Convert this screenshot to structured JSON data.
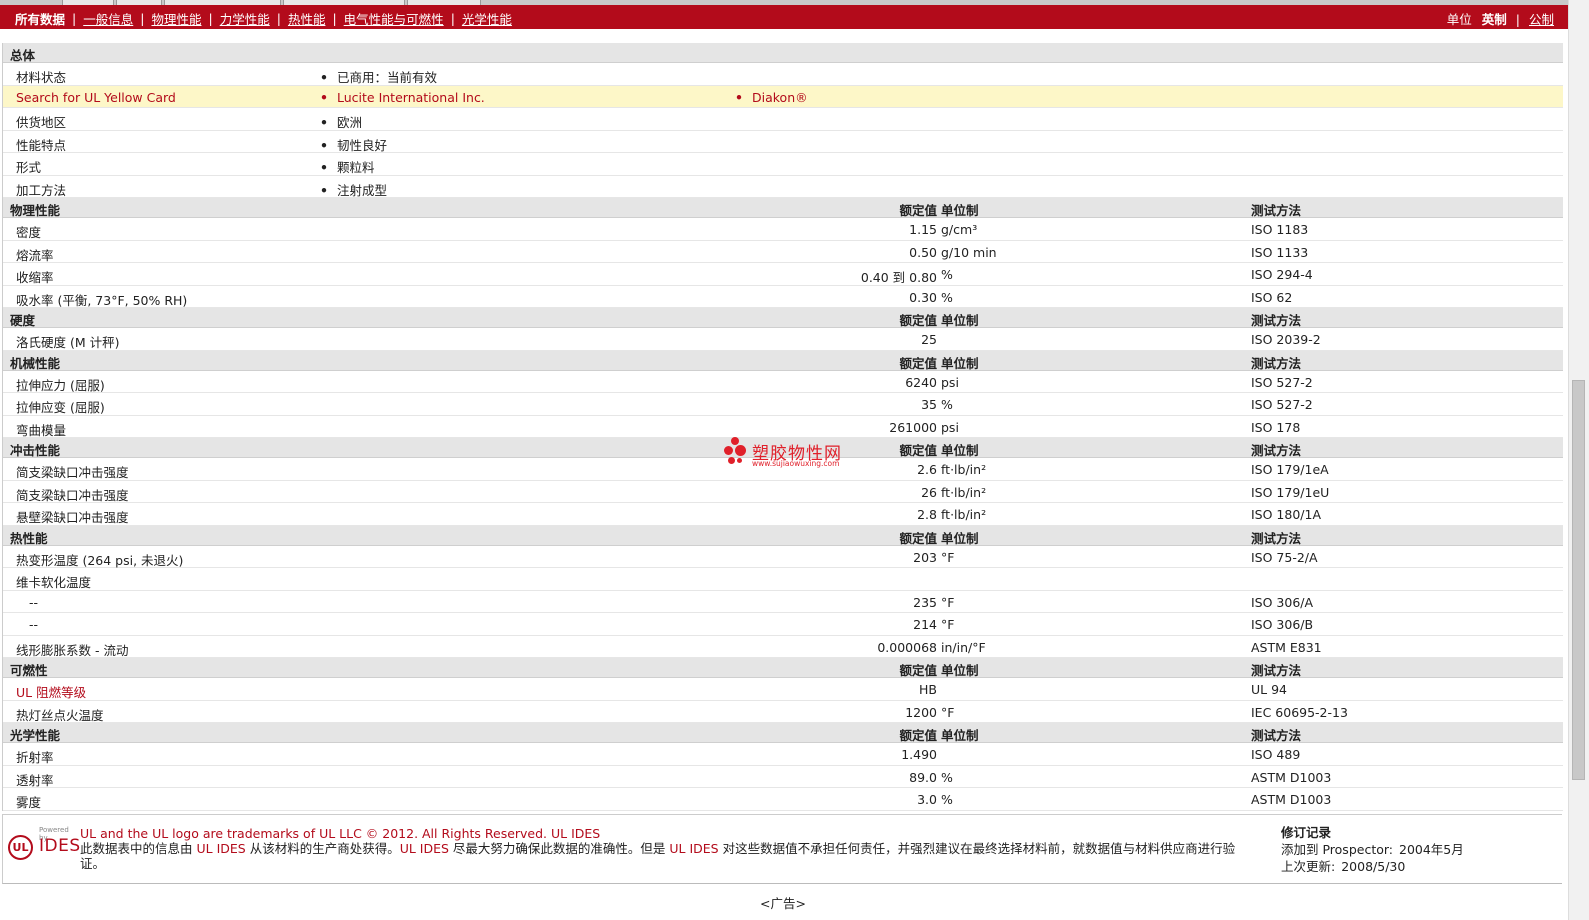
{
  "nav": {
    "items": [
      "所有数据",
      "一般信息",
      "物理性能",
      "力学性能",
      "热性能",
      "电气性能与可燃性",
      "光学性能"
    ],
    "active": "所有数据",
    "units_label": "单位",
    "units_current": "英制",
    "units_alt": "公制"
  },
  "colors": {
    "brand": "#b30b1b",
    "highlight": "#fdf7c8",
    "section_bg": "#e5e5e5"
  },
  "general": {
    "title": "总体",
    "rows": [
      {
        "name": "材料状态",
        "b1": "已商用：当前有效"
      },
      {
        "name": "Search for UL Yellow Card",
        "b1": "Lucite International Inc.",
        "b2": "Diakon®"
      },
      {
        "name": "供货地区",
        "b1": "欧洲"
      },
      {
        "name": "性能特点",
        "b1": "韧性良好"
      },
      {
        "name": "形式",
        "b1": "颗粒料"
      },
      {
        "name": "加工方法",
        "b1": "注射成型"
      }
    ]
  },
  "headers": {
    "value": "额定值",
    "unit": "单位制",
    "test": "测试方法"
  },
  "sections": [
    {
      "title": "物理性能",
      "rows": [
        {
          "name": "密度",
          "value": "1.15",
          "unit": "g/cm³",
          "test": "ISO 1183"
        },
        {
          "name": "熔流率",
          "value": "0.50",
          "unit": "g/10 min",
          "test": "ISO 1133"
        },
        {
          "name": "收缩率",
          "value": "0.40 到  0.80",
          "unit": "%",
          "test": "ISO 294-4"
        },
        {
          "name": "吸水率 (平衡, 73°F, 50% RH)",
          "value": "0.30",
          "unit": "%",
          "test": "ISO 62"
        }
      ]
    },
    {
      "title": "硬度",
      "rows": [
        {
          "name": "洛氏硬度 (M 计秤)",
          "value": "25",
          "unit": "",
          "test": "ISO 2039-2"
        }
      ]
    },
    {
      "title": "机械性能",
      "rows": [
        {
          "name": "拉伸应力 (屈服)",
          "value": "6240",
          "unit": "psi",
          "test": "ISO 527-2"
        },
        {
          "name": "拉伸应变 (屈服)",
          "value": "35",
          "unit": "%",
          "test": "ISO 527-2"
        },
        {
          "name": "弯曲模量",
          "value": "261000",
          "unit": "psi",
          "test": "ISO 178"
        }
      ]
    },
    {
      "title": "冲击性能",
      "rows": [
        {
          "name": "简支梁缺口冲击强度",
          "value": "2.6",
          "unit": "ft·lb/in²",
          "test": "ISO 179/1eA"
        },
        {
          "name": "简支梁缺口冲击强度",
          "value": "26",
          "unit": "ft·lb/in²",
          "test": "ISO 179/1eU"
        },
        {
          "name": "悬壁梁缺口冲击强度",
          "value": "2.8",
          "unit": "ft·lb/in²",
          "test": "ISO 180/1A"
        }
      ]
    },
    {
      "title": "热性能",
      "rows": [
        {
          "name": "热变形温度 (264 psi, 未退火)",
          "value": "203",
          "unit": "°F",
          "test": "ISO 75-2/A"
        },
        {
          "name": "维卡软化温度",
          "value": "",
          "unit": "",
          "test": ""
        },
        {
          "name": "--",
          "value": "235",
          "unit": "°F",
          "test": "ISO 306/A",
          "indent": true
        },
        {
          "name": "--",
          "value": "214",
          "unit": "°F",
          "test": "ISO 306/B",
          "indent": true
        },
        {
          "name": "线形膨胀系数  - 流动",
          "value": "0.000068",
          "unit": "in/in/°F",
          "test": "ASTM E831"
        }
      ]
    },
    {
      "title": "可燃性",
      "rows": [
        {
          "name": "UL 阻燃等级",
          "value": "HB",
          "unit": "",
          "test": "UL 94",
          "link": true
        },
        {
          "name": "热灯丝点火温度",
          "value": "1200",
          "unit": "°F",
          "test": "IEC 60695-2-13"
        }
      ]
    },
    {
      "title": "光学性能",
      "rows": [
        {
          "name": "折射率",
          "value": "1.490",
          "unit": "",
          "test": "ISO 489"
        },
        {
          "name": "透射率",
          "value": "89.0",
          "unit": "%",
          "test": "ASTM D1003"
        },
        {
          "name": "雾度",
          "value": "3.0",
          "unit": "%",
          "test": "ASTM D1003"
        }
      ]
    }
  ],
  "watermark": {
    "text": "塑胶物性网",
    "url": "www.sujiaowuxing.com"
  },
  "footer": {
    "logo_powered": "Powered by",
    "logo_ul": "UL",
    "logo_ides": "IDES",
    "line1": "UL and the UL logo are trademarks of UL LLC © 2012. All Rights Reserved. UL IDES",
    "line2_a": "此数据表中的信息由 ",
    "line2_link1": "UL IDES",
    "line2_b": " 从该材料的生产商处获得。",
    "line2_link2": "UL IDES",
    "line2_c": " 尽最大努力确保此数据的准确性。但是 ",
    "line2_link3": "UL IDES",
    "line2_d": " 对这些数据值不承担任何责任，并强烈建议在最终选择材料前，就数据值与材料供应商进行验证。",
    "rev_title": "修订记录",
    "rev_added_label": "添加到  Prospector:",
    "rev_added_value": "2004年5月",
    "rev_updated_label": "上次更新:",
    "rev_updated_value": "2008/5/30",
    "ad": "<广告>"
  }
}
